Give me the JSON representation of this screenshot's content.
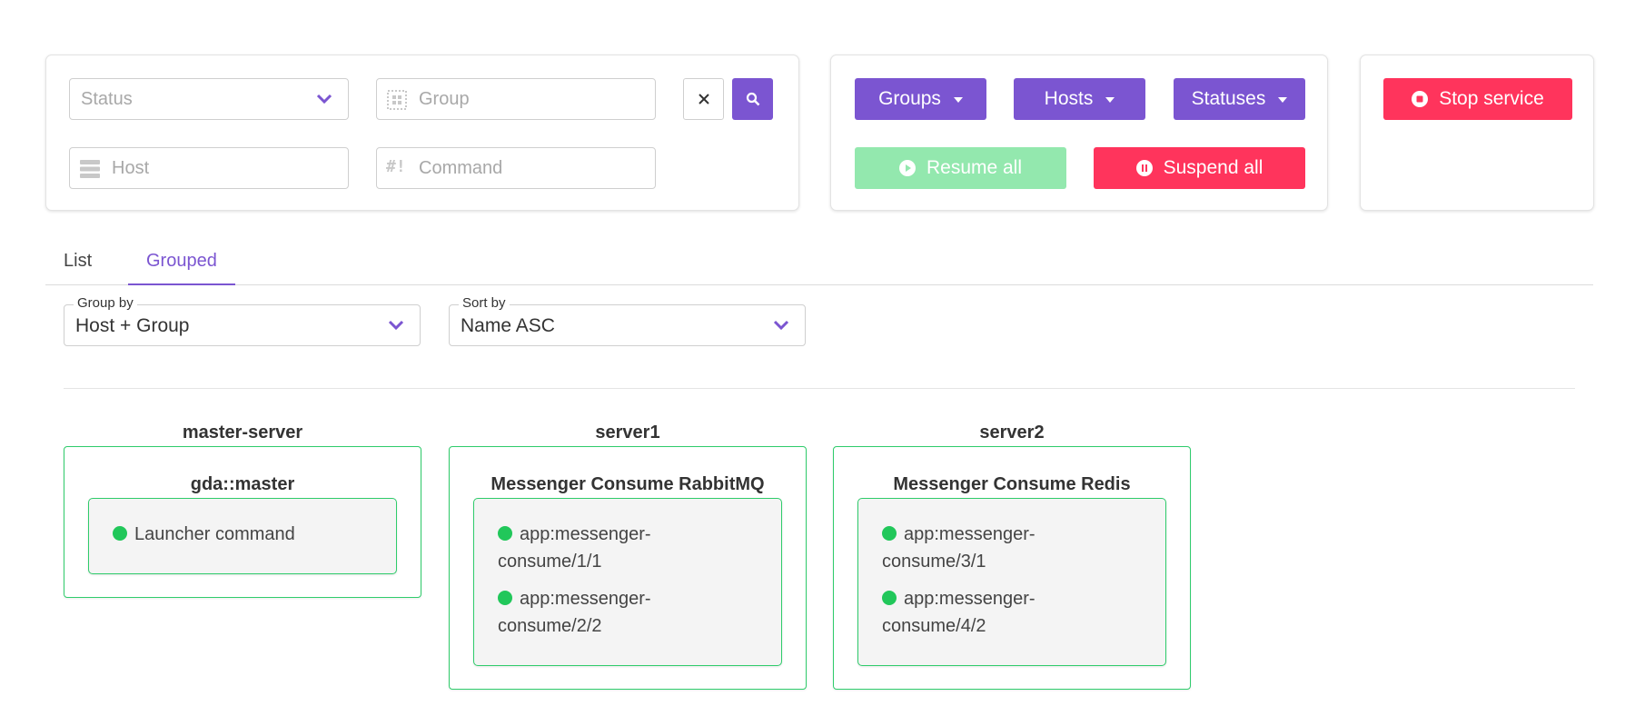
{
  "filters": {
    "status_placeholder": "Status",
    "group_placeholder": "Group",
    "host_placeholder": "Host",
    "command_placeholder": "Command"
  },
  "actions": {
    "groups_label": "Groups",
    "hosts_label": "Hosts",
    "statuses_label": "Statuses",
    "resume_all_label": "Resume all",
    "suspend_all_label": "Suspend all",
    "stop_service_label": "Stop service"
  },
  "tabs": [
    {
      "label": "List",
      "active": false
    },
    {
      "label": "Grouped",
      "active": true
    }
  ],
  "group_by": {
    "legend": "Group by",
    "value": "Host + Group"
  },
  "sort_by": {
    "legend": "Sort by",
    "value": "Name ASC"
  },
  "hosts": [
    {
      "name": "master-server",
      "group": "gda::master",
      "processes": [
        "Launcher command"
      ]
    },
    {
      "name": "server1",
      "group": "Messenger Consume RabbitMQ",
      "processes": [
        "app:messenger-consume/1/1",
        "app:messenger-consume/2/2"
      ]
    },
    {
      "name": "server2",
      "group": "Messenger Consume Redis",
      "processes": [
        "app:messenger-consume/3/1",
        "app:messenger-consume/4/2"
      ]
    }
  ],
  "colors": {
    "accent": "#7b55d1",
    "danger": "#ff345c",
    "success": "#21c75a",
    "success_light": "#93e8ae"
  }
}
